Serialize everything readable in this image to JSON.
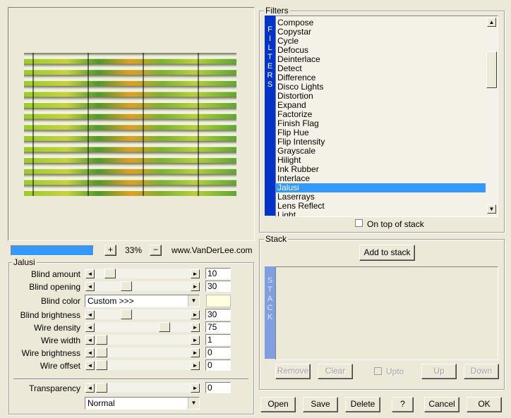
{
  "preview": {
    "zoom": "33%",
    "zoom_in": "+",
    "zoom_out": "−",
    "website": "www.VanDerLee.com"
  },
  "filters": {
    "legend": "Filters",
    "side_label": "FILTERS",
    "items": [
      "Compose",
      "Copystar",
      "Cycle",
      "Defocus",
      "Deinterlace",
      "Detect",
      "Difference",
      "Disco Lights",
      "Distortion",
      "Expand",
      "Factorize",
      "Finish Flag",
      "Flip Hue",
      "Flip Intensity",
      "Grayscale",
      "Hilight",
      "Ink Rubber",
      "Interlace",
      "Jalusi",
      "Laserrays",
      "Lens Reflect",
      "Light"
    ],
    "selected": "Jalusi",
    "on_top_label": "On top of stack"
  },
  "params": {
    "legend": "Jalusi",
    "sliders": [
      {
        "label": "Blind amount",
        "value": "10",
        "level": 0.1
      },
      {
        "label": "Blind opening",
        "value": "30",
        "level": 0.3
      },
      {
        "label": "Blind brightness",
        "value": "30",
        "level": 0.3
      },
      {
        "label": "Wire density",
        "value": "75",
        "level": 0.75
      },
      {
        "label": "Wire width",
        "value": "1",
        "level": 0.0
      },
      {
        "label": "Wire brightness",
        "value": "0",
        "level": 0.0
      },
      {
        "label": "Wire offset",
        "value": "0",
        "level": 0.0
      }
    ],
    "blind_color": {
      "label": "Blind color",
      "value": "Custom >>>",
      "swatch": "#ffffe0"
    },
    "transparency": {
      "label": "Transparency",
      "value": "0",
      "level": 0.0
    },
    "blend_mode": "Normal"
  },
  "stack": {
    "legend": "Stack",
    "add_label": "Add to stack",
    "side_label": "STACK",
    "remove_label": "Remove",
    "clear_label": "Clear",
    "upto_label": "Upto",
    "up_label": "Up",
    "down_label": "Down"
  },
  "footer": {
    "open": "Open",
    "save": "Save",
    "delete": "Delete",
    "help": "?",
    "cancel": "Cancel",
    "ok": "OK"
  },
  "colors": {
    "selection": "#3399ff",
    "filters_bar": "#0033cc",
    "stack_bar": "#7f9fe0",
    "progress": "#3399ff"
  }
}
